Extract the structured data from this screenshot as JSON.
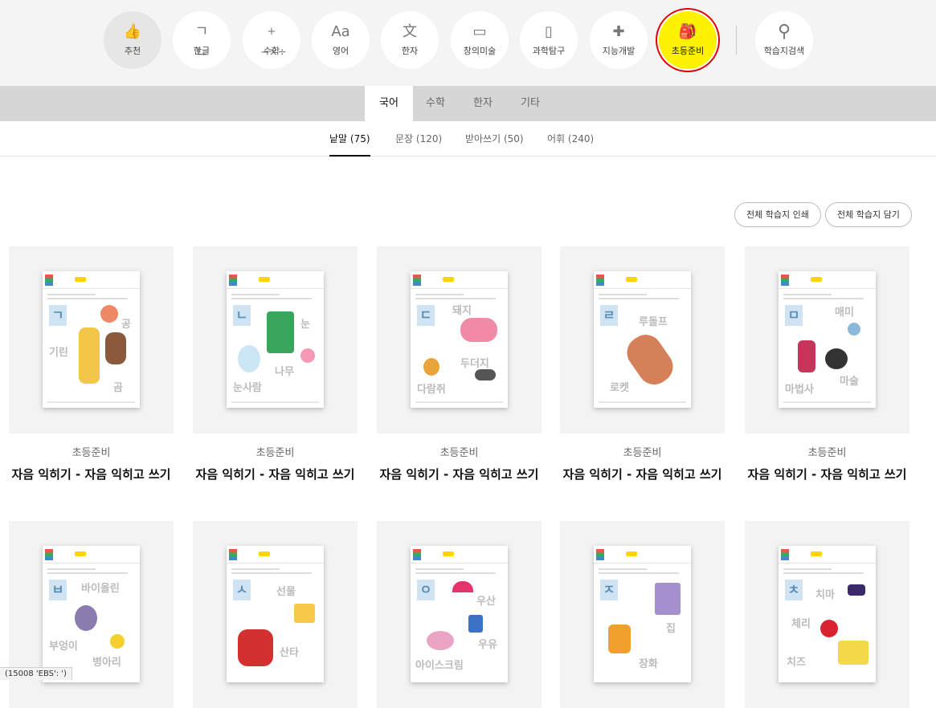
{
  "categories": [
    {
      "label": "추천",
      "icon": "thumbs-up-icon",
      "glyph": "👍"
    },
    {
      "label": "한글",
      "icon": "hangul-icon",
      "glyph": "ㄱㄴ"
    },
    {
      "label": "수학",
      "icon": "math-icon",
      "glyph": "+−×÷"
    },
    {
      "label": "영어",
      "icon": "english-icon",
      "glyph": "Aa"
    },
    {
      "label": "한자",
      "icon": "hanja-icon",
      "glyph": "文"
    },
    {
      "label": "창의미술",
      "icon": "art-icon",
      "glyph": "▭"
    },
    {
      "label": "과학탐구",
      "icon": "science-icon",
      "glyph": "▯"
    },
    {
      "label": "지능개발",
      "icon": "puzzle-icon",
      "glyph": "✚"
    },
    {
      "label": "초등준비",
      "icon": "backpack-icon",
      "glyph": "🎒"
    },
    {
      "label": "학습지검색",
      "icon": "search-icon",
      "glyph": "⚲"
    }
  ],
  "subject_tabs": [
    "국어",
    "수학",
    "한자",
    "기타"
  ],
  "filter_tabs": [
    "낱말 (75)",
    "문장 (120)",
    "받아쓰기 (50)",
    "어휘 (240)"
  ],
  "actions": {
    "print_all": "전체 학습지 인쇄",
    "save_all": "전체 학습지 담기"
  },
  "cards": [
    {
      "category": "초등준비",
      "title": "자음 익히기 - 자음 익히고 쓰기",
      "letter": "ㄱ",
      "words": [
        "공",
        "기린",
        "곰"
      ]
    },
    {
      "category": "초등준비",
      "title": "자음 익히기 - 자음 익히고 쓰기",
      "letter": "ㄴ",
      "words": [
        "눈",
        "나무",
        "눈사람"
      ]
    },
    {
      "category": "초등준비",
      "title": "자음 익히기 - 자음 익히고 쓰기",
      "letter": "ㄷ",
      "words": [
        "돼지",
        "두더지",
        "다람쥐"
      ]
    },
    {
      "category": "초등준비",
      "title": "자음 익히기 - 자음 익히고 쓰기",
      "letter": "ㄹ",
      "words": [
        "루돌프",
        "로켓"
      ]
    },
    {
      "category": "초등준비",
      "title": "자음 익히기 - 자음 익히고 쓰기",
      "letter": "ㅁ",
      "words": [
        "매미",
        "마법사",
        "마술"
      ]
    },
    {
      "letter": "ㅂ",
      "words": [
        "바이올린",
        "부엉이",
        "병아리"
      ]
    },
    {
      "letter": "ㅅ",
      "words": [
        "선물",
        "산타"
      ]
    },
    {
      "letter": "ㅇ",
      "words": [
        "우산",
        "우유",
        "아이스크림"
      ]
    },
    {
      "letter": "ㅈ",
      "words": [
        "집",
        "장화"
      ]
    },
    {
      "letter": "ㅊ",
      "words": [
        "치마",
        "체리",
        "치즈"
      ]
    }
  ],
  "status_text": "(15008 'EBS': ')"
}
